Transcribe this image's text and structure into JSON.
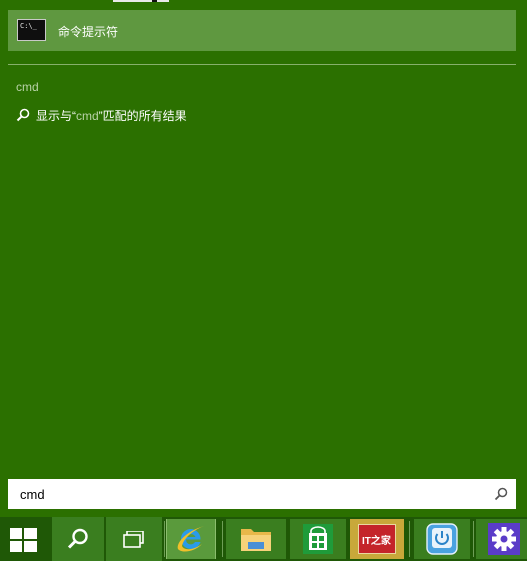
{
  "results": {
    "best_match_label": "命令提示符",
    "cmd_icon_text": "C:\\_",
    "section_heading": "cmd",
    "search_web_prefix": "显示与“",
    "search_web_query": "cmd",
    "search_web_suffix": "”匹配的所有结果"
  },
  "search": {
    "value": "cmd",
    "placeholder": ""
  },
  "taskbar": {
    "items": [
      {
        "icon": "windows-start-icon"
      },
      {
        "icon": "search-icon"
      },
      {
        "icon": "task-view-icon"
      },
      {
        "icon": "internet-explorer-icon"
      },
      {
        "icon": "file-explorer-icon"
      },
      {
        "icon": "store-icon"
      },
      {
        "icon": "ithome-icon",
        "label": "IT之家"
      },
      {
        "icon": "power-icon"
      },
      {
        "icon": "settings-icon"
      }
    ]
  },
  "colors": {
    "background": "#2b7000",
    "highlight": "#5f9840",
    "taskbar": "#1f5806",
    "accent_text": "#b9d3a8"
  }
}
